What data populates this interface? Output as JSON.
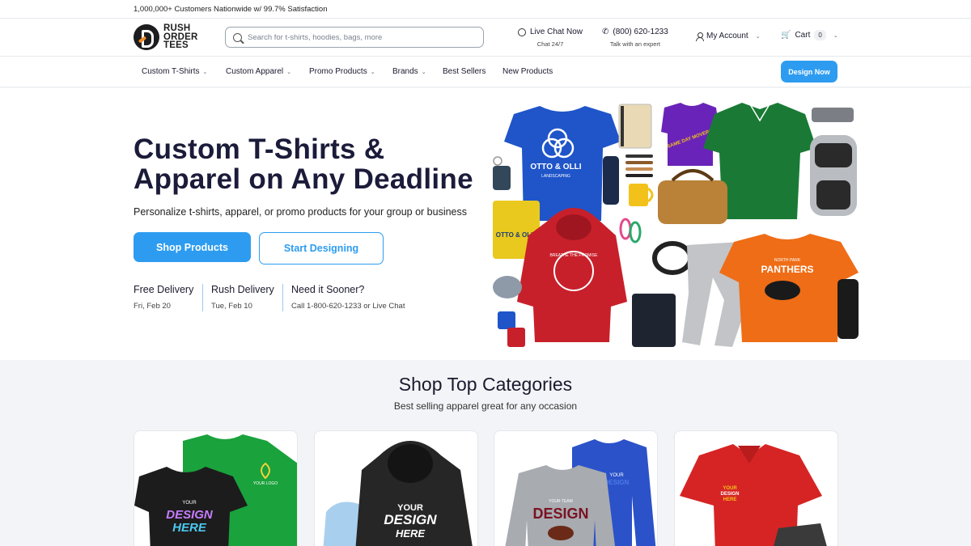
{
  "topbar": {
    "text": "1,000,000+ Customers Nationwide w/ 99.7% Satisfaction"
  },
  "logo": {
    "line1": "RUSH",
    "line2": "ORDER",
    "line3": "TEES"
  },
  "search": {
    "placeholder": "Search for t-shirts, hoodies, bags, more"
  },
  "header": {
    "chat": {
      "label": "Live Chat Now",
      "sub": "Chat 24/7"
    },
    "phone": {
      "label": "(800) 620-1233",
      "sub": "Talk with an expert"
    },
    "account": {
      "label": "My Account"
    },
    "cart": {
      "label": "Cart",
      "count": "0"
    }
  },
  "nav": {
    "items": [
      "Custom T-Shirts",
      "Custom Apparel",
      "Promo Products",
      "Brands",
      "Best Sellers",
      "New Products"
    ],
    "cta": "Design Now"
  },
  "hero": {
    "title_line1": "Custom T-Shirts &",
    "title_line2": "Apparel on Any Deadline",
    "subtitle": "Personalize t-shirts, apparel, or promo products for your group or business",
    "btn_shop": "Shop Products",
    "btn_start": "Start Designing",
    "delivery": [
      {
        "title": "Free Delivery",
        "sub": "Fri, Feb 20"
      },
      {
        "title": "Rush Delivery",
        "sub": "Tue, Feb 10"
      },
      {
        "title": "Need it Sooner?",
        "sub": "Call 1-800-620-1233 or Live Chat"
      }
    ],
    "img_text": {
      "blue_tee": "OTTO & OLLI",
      "blue_tee_sub": "LANDSCAPING",
      "yellow_tee": "OTTO & OLLI",
      "purple_tee": "SAME DAY MOVERS",
      "hoodie": "BREATHE THE PROMISE",
      "orange_tee": "PANTHERS",
      "orange_tee_top": "NORTH PARK"
    }
  },
  "categories": {
    "title": "Shop Top Categories",
    "subtitle": "Best selling apparel great for any occasion",
    "cards": [
      {
        "line1": "YOUR",
        "line2": "DESIGN",
        "line3": "HERE",
        "badge": "YOUR LOGO"
      },
      {
        "line1": "YOUR",
        "line2": "DESIGN",
        "line3": "HERE"
      },
      {
        "line1": "YOUR TEAM",
        "line2": "DESIGN",
        "line3": "YOUR",
        "line4": "DESIGN"
      },
      {
        "line1": "YOUR",
        "line2": "DESIGN",
        "line3": "HERE"
      }
    ]
  },
  "colors": {
    "accent": "#2d9cf0",
    "navy": "#1b1b3a",
    "section_bg": "#f2f4f7"
  }
}
